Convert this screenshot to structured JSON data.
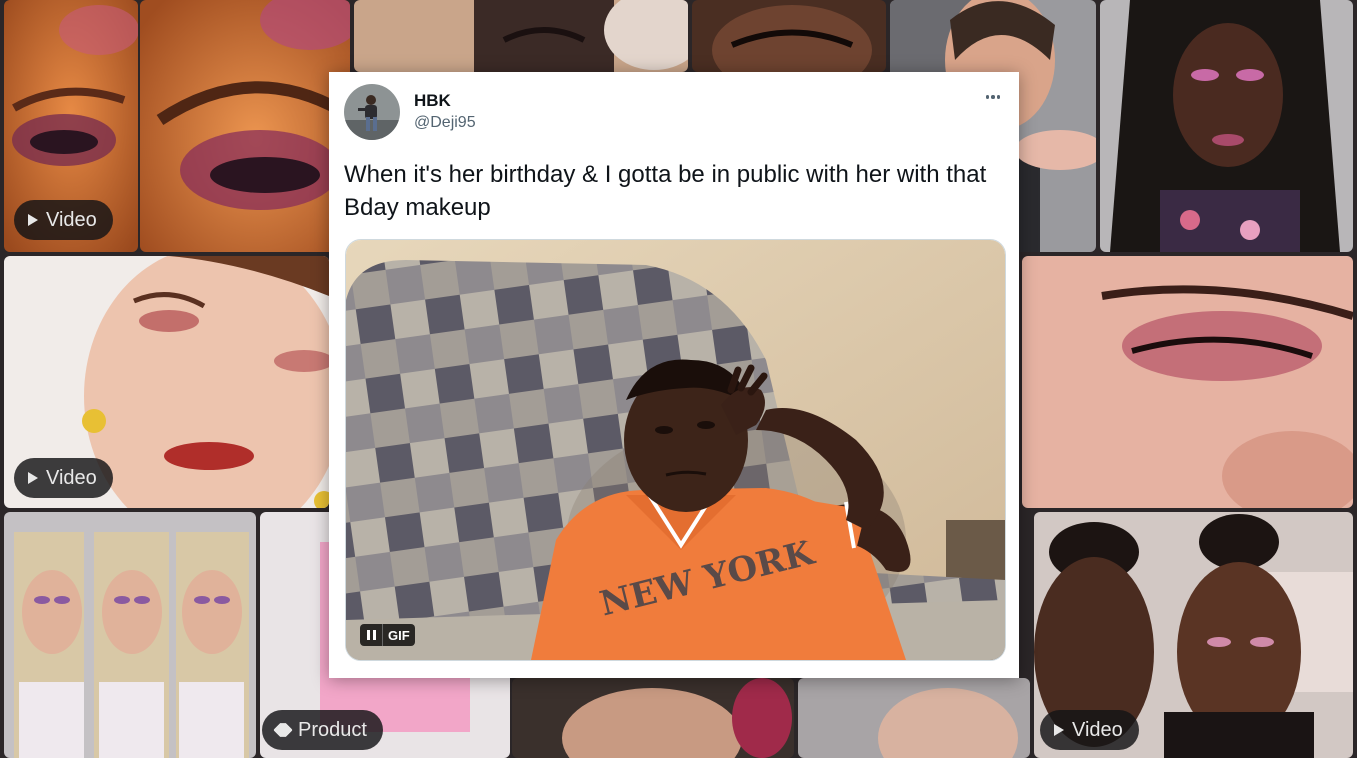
{
  "background": {
    "badges": {
      "video_1": "Video",
      "video_2": "Video",
      "product": "Product",
      "video_3": "Video"
    }
  },
  "tweet": {
    "display_name": "HBK",
    "handle": "@Deji95",
    "text": "When it's her birthday & I gotta be in public with her with that Bday makeup",
    "media": {
      "type_label": "GIF",
      "jersey_text": "NEW YORK"
    }
  },
  "colors": {
    "card_bg": "#ffffff",
    "text_primary": "#0f1419",
    "text_secondary": "#536471",
    "jersey": "#f07c3c",
    "wall": "#d9c3a3"
  }
}
